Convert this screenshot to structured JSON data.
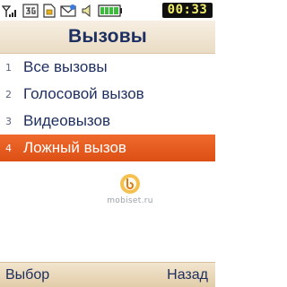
{
  "status_bar": {
    "icons": [
      "signal-strength-icon",
      "network-icon",
      "sim-card-icon",
      "email-icon",
      "speaker-icon",
      "battery-icon"
    ],
    "time": "00:33"
  },
  "title": "Вызовы",
  "menu": {
    "items": [
      {
        "num": "1",
        "label": "Все вызовы"
      },
      {
        "num": "2",
        "label": "Голосовой вызов"
      },
      {
        "num": "3",
        "label": "Видеовызов"
      },
      {
        "num": "4",
        "label": "Ложный вызов"
      }
    ],
    "selected_index": 3
  },
  "watermark": {
    "text": "mobiset.ru"
  },
  "softkeys": {
    "left": "Выбор",
    "right": "Назад"
  },
  "colors": {
    "accent": "#e95a20",
    "text": "#1d2e5f",
    "title_bar": "#eadcc4",
    "clock_bg": "#111111",
    "clock_text": "#f3f06b"
  }
}
